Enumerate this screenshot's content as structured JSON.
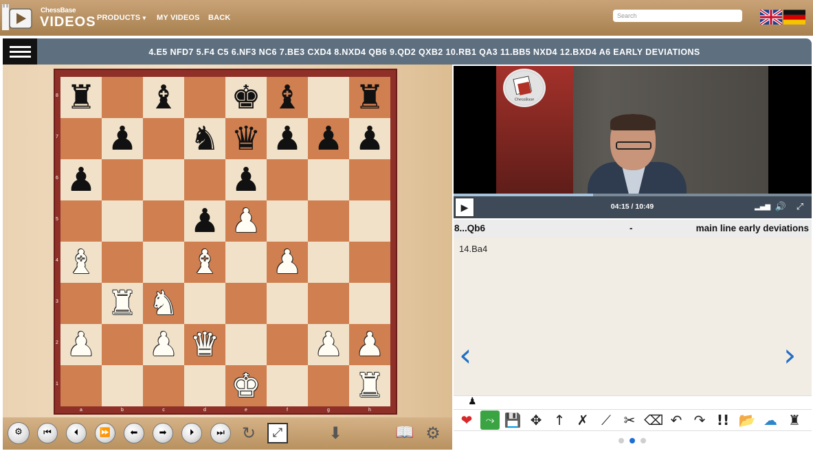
{
  "nav": {
    "logo_sub": "ChessBase",
    "logo_main": "VIDEOS",
    "links": [
      "PRODUCTS",
      "MY VIDEOS",
      "BACK"
    ],
    "products_caret": "▾",
    "search_placeholder": "Search"
  },
  "game": {
    "title": "4.E5 NFD7 5.F4 C5 6.NF3 NC6 7.BE3 CXD4 8.NXD4 QB6 9.QD2 QXB2 10.RB1 QA3 11.BB5 NXD4 12.BXD4 A6 EARLY DEVIATIONS"
  },
  "board": {
    "ranks": [
      "8",
      "7",
      "6",
      "5",
      "4",
      "3",
      "2",
      "1"
    ],
    "files": [
      "a",
      "b",
      "c",
      "d",
      "e",
      "f",
      "g",
      "h"
    ],
    "pieces": [
      {
        "sq": "a8",
        "p": "r"
      },
      {
        "sq": "c8",
        "p": "b"
      },
      {
        "sq": "e8",
        "p": "k"
      },
      {
        "sq": "f8",
        "p": "b"
      },
      {
        "sq": "h8",
        "p": "r"
      },
      {
        "sq": "b7",
        "p": "p"
      },
      {
        "sq": "d7",
        "p": "n"
      },
      {
        "sq": "e7",
        "p": "q"
      },
      {
        "sq": "f7",
        "p": "p"
      },
      {
        "sq": "g7",
        "p": "p"
      },
      {
        "sq": "h7",
        "p": "p"
      },
      {
        "sq": "a6",
        "p": "p"
      },
      {
        "sq": "e6",
        "p": "p"
      },
      {
        "sq": "d5",
        "p": "p"
      },
      {
        "sq": "e5",
        "p": "P"
      },
      {
        "sq": "a4",
        "p": "B"
      },
      {
        "sq": "d4",
        "p": "B"
      },
      {
        "sq": "f4",
        "p": "P"
      },
      {
        "sq": "b3",
        "p": "R"
      },
      {
        "sq": "c3",
        "p": "N"
      },
      {
        "sq": "a2",
        "p": "P"
      },
      {
        "sq": "c2",
        "p": "P"
      },
      {
        "sq": "d2",
        "p": "Q"
      },
      {
        "sq": "g2",
        "p": "P"
      },
      {
        "sq": "h2",
        "p": "P"
      },
      {
        "sq": "e1",
        "p": "K"
      },
      {
        "sq": "h1",
        "p": "R"
      }
    ]
  },
  "video": {
    "time": "04:15 / 10:49",
    "progress": 0.39,
    "logo_text": "ChessBase"
  },
  "notation": {
    "current_move": "8...Qb6",
    "separator": "-",
    "line_name": "main line early deviations",
    "move_text": "14.Ba4"
  },
  "carousel": {
    "count": 3,
    "active": 1
  },
  "colors": {
    "nav_bg": "#b8915f",
    "title_bar": "#5e6f7f",
    "square_light": "#f1e1c8",
    "square_dark": "#cf7f50",
    "accent_blue": "#1f6fc6"
  }
}
